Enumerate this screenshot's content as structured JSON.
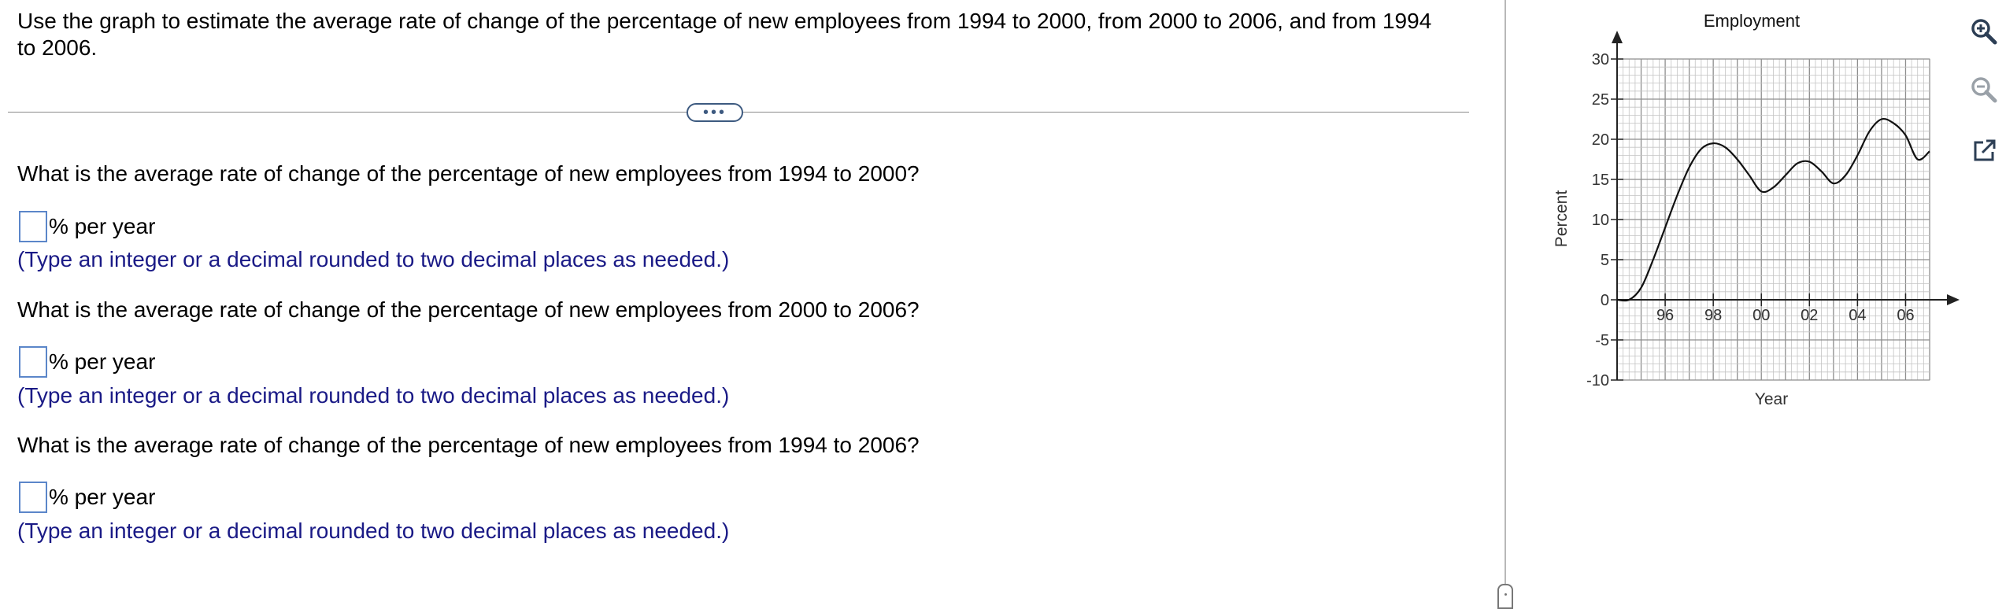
{
  "problem": {
    "prompt": "Use the graph to estimate the average rate of change of the percentage of new employees from 1994 to 2000, from 2000 to 2006, and from 1994 to 2006.",
    "expander_label": "•••"
  },
  "questions": [
    {
      "text": "What is the average rate of change of the percentage of new employees from 1994 to 2000?",
      "unit": "% per year",
      "hint": "(Type an integer or a decimal rounded to two decimal places as needed.)"
    },
    {
      "text": "What is the average rate of change of the percentage of new employees from 2000 to 2006?",
      "unit": "% per year",
      "hint": "(Type an integer or a decimal rounded to two decimal places as needed.)"
    },
    {
      "text": "What is the average rate of change of the percentage of new employees from 1994 to 2006?",
      "unit": "% per year",
      "hint": "(Type an integer or a decimal rounded to two decimal places as needed.)"
    }
  ],
  "toolbar": {
    "zoom_in": "zoom-in-icon",
    "zoom_out": "zoom-out-icon",
    "open_new": "open-external-icon"
  },
  "chart_data": {
    "type": "line",
    "title": "Employment",
    "xlabel": "Year",
    "ylabel": "Percent",
    "x_tick_labels": [
      "96",
      "98",
      "00",
      "02",
      "04",
      "06"
    ],
    "x_tick_values": [
      1996,
      1998,
      2000,
      2002,
      2004,
      2006
    ],
    "y_tick_labels": [
      "30",
      "25",
      "20",
      "15",
      "10",
      "5",
      "0",
      "-5",
      "-10"
    ],
    "y_tick_values": [
      30,
      25,
      20,
      15,
      10,
      5,
      0,
      -5,
      -10
    ],
    "xlim": [
      1994,
      2007
    ],
    "ylim": [
      -10,
      30
    ],
    "grid": true,
    "series": [
      {
        "x": [
          1994,
          1994.5,
          1995,
          1995.5,
          1996,
          1996.5,
          1997,
          1997.5,
          1998,
          1998.5,
          1999,
          1999.5,
          2000,
          2000.5,
          2001,
          2001.5,
          2002,
          2002.5,
          2003,
          2003.5,
          2004,
          2004.5,
          2005,
          2005.5,
          2006,
          2006.5,
          2007
        ],
        "y": [
          0,
          0,
          1.5,
          5,
          9,
          13,
          16.5,
          18.8,
          19.5,
          19,
          17.5,
          15.5,
          13.5,
          14,
          15.5,
          17,
          17.2,
          16,
          14.5,
          15.5,
          18,
          21,
          22.5,
          22,
          20.5,
          17.5,
          18.5
        ]
      }
    ]
  }
}
